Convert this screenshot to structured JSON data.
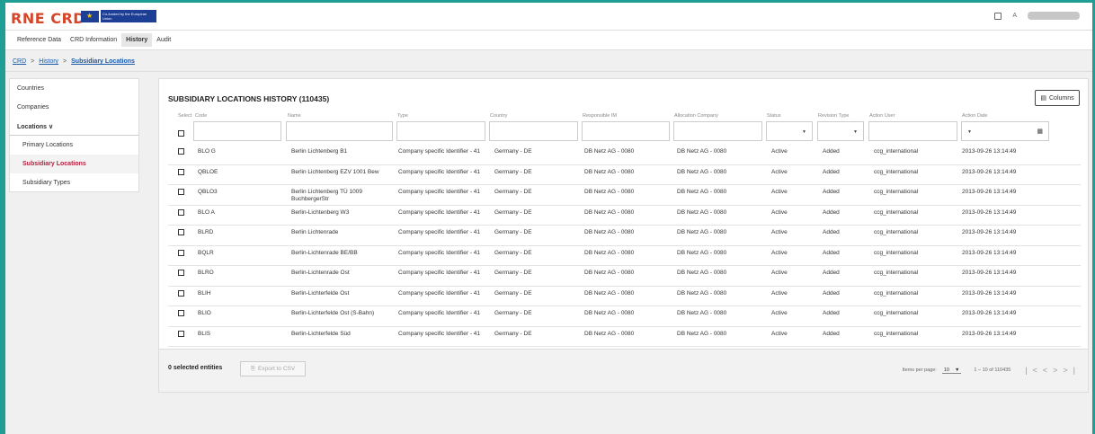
{
  "topbar": {
    "logo_text": "RNE CRD",
    "eu_text": "Co-funded by the European Union",
    "user_prefix": "A"
  },
  "nav": {
    "items": [
      {
        "label": "Reference Data",
        "active": false
      },
      {
        "label": "CRD Information",
        "active": false
      },
      {
        "label": "History",
        "active": true
      },
      {
        "label": "Audit",
        "active": false
      }
    ]
  },
  "breadcrumb": {
    "root": "CRD",
    "sep1": ">",
    "middle": "History",
    "sep2": ">",
    "current": "Subsidiary Locations"
  },
  "sidebar": {
    "items": [
      {
        "label": "Countries"
      },
      {
        "label": "Companies"
      },
      {
        "label": "Locations ∨"
      },
      {
        "label": "Primary Locations"
      },
      {
        "label": "Subsidiary Locations"
      },
      {
        "label": "Subsidiary Types"
      }
    ]
  },
  "panel": {
    "title": "SUBSIDIARY LOCATIONS HISTORY (110435)",
    "columns_button": "Columns",
    "headers": {
      "select": "Select",
      "code": "Code",
      "name": "Name",
      "type": "Type",
      "country": "Country",
      "responsible_im": "Responsible IM",
      "allocation_company": "Allocation Company",
      "status": "Status",
      "revision_type": "Revision Type",
      "action_user": "Action User",
      "action_date": "Action Date"
    }
  },
  "rows": [
    {
      "code": "BLO G",
      "name": "Berlin Lichtenberg B1",
      "type": "Company specific Identifier - 41",
      "country": "Germany - DE",
      "im": "DB Netz AG - 0080",
      "alloc": "DB Netz AG - 0080",
      "status": "Active",
      "revision": "Added",
      "user": "ccg_international",
      "date": "2013-09-26 13:14:49"
    },
    {
      "code": "QBLOE",
      "name": "Berlin Lichtenberg EZV 1001 Bew",
      "type": "Company specific Identifier - 41",
      "country": "Germany - DE",
      "im": "DB Netz AG - 0080",
      "alloc": "DB Netz AG - 0080",
      "status": "Active",
      "revision": "Added",
      "user": "ccg_international",
      "date": "2013-09-26 13:14:49"
    },
    {
      "code": "QBLO3",
      "name": "Berlin Lichtenberg TÜ 1009 BuchbergerStr",
      "type": "Company specific Identifier - 41",
      "country": "Germany - DE",
      "im": "DB Netz AG - 0080",
      "alloc": "DB Netz AG - 0080",
      "status": "Active",
      "revision": "Added",
      "user": "ccg_international",
      "date": "2013-09-26 13:14:49"
    },
    {
      "code": "BLO A",
      "name": "Berlin-Lichtenberg W3",
      "type": "Company specific Identifier - 41",
      "country": "Germany - DE",
      "im": "DB Netz AG - 0080",
      "alloc": "DB Netz AG - 0080",
      "status": "Active",
      "revision": "Added",
      "user": "ccg_international",
      "date": "2013-09-26 13:14:49"
    },
    {
      "code": "BLRD",
      "name": "Berlin Lichtenrade",
      "type": "Company specific Identifier - 41",
      "country": "Germany - DE",
      "im": "DB Netz AG - 0080",
      "alloc": "DB Netz AG - 0080",
      "status": "Active",
      "revision": "Added",
      "user": "ccg_international",
      "date": "2013-09-26 13:14:49"
    },
    {
      "code": "BQLR",
      "name": "Berlin-Lichtenrade BE/BB",
      "type": "Company specific Identifier - 41",
      "country": "Germany - DE",
      "im": "DB Netz AG - 0080",
      "alloc": "DB Netz AG - 0080",
      "status": "Active",
      "revision": "Added",
      "user": "ccg_international",
      "date": "2013-09-26 13:14:49"
    },
    {
      "code": "BLRO",
      "name": "Berlin-Lichtenrade Ost",
      "type": "Company specific Identifier - 41",
      "country": "Germany - DE",
      "im": "DB Netz AG - 0080",
      "alloc": "DB Netz AG - 0080",
      "status": "Active",
      "revision": "Added",
      "user": "ccg_international",
      "date": "2013-09-26 13:14:49"
    },
    {
      "code": "BLIH",
      "name": "Berlin-Lichterfelde Ost",
      "type": "Company specific Identifier - 41",
      "country": "Germany - DE",
      "im": "DB Netz AG - 0080",
      "alloc": "DB Netz AG - 0080",
      "status": "Active",
      "revision": "Added",
      "user": "ccg_international",
      "date": "2013-09-26 13:14:49"
    },
    {
      "code": "BLIO",
      "name": "Berlin-Lichterfelde Ost (S-Bahn)",
      "type": "Company specific Identifier - 41",
      "country": "Germany - DE",
      "im": "DB Netz AG - 0080",
      "alloc": "DB Netz AG - 0080",
      "status": "Active",
      "revision": "Added",
      "user": "ccg_international",
      "date": "2013-09-26 13:14:49"
    },
    {
      "code": "BLIS",
      "name": "Berlin-Lichterfelde Süd",
      "type": "Company specific Identifier - 41",
      "country": "Germany - DE",
      "im": "DB Netz AG - 0080",
      "alloc": "DB Netz AG - 0080",
      "status": "Active",
      "revision": "Added",
      "user": "ccg_international",
      "date": "2013-09-26 13:14:49"
    }
  ],
  "footer": {
    "selected": "0 selected entities",
    "export": "Export to CSV",
    "items_per_page_label": "Items per page:",
    "items_per_page_value": "10",
    "range": "1 – 10 of 110435"
  },
  "colors": {
    "frame": "#1e9e94",
    "accent_red": "#b5213f",
    "link_blue": "#1a5aa8"
  }
}
